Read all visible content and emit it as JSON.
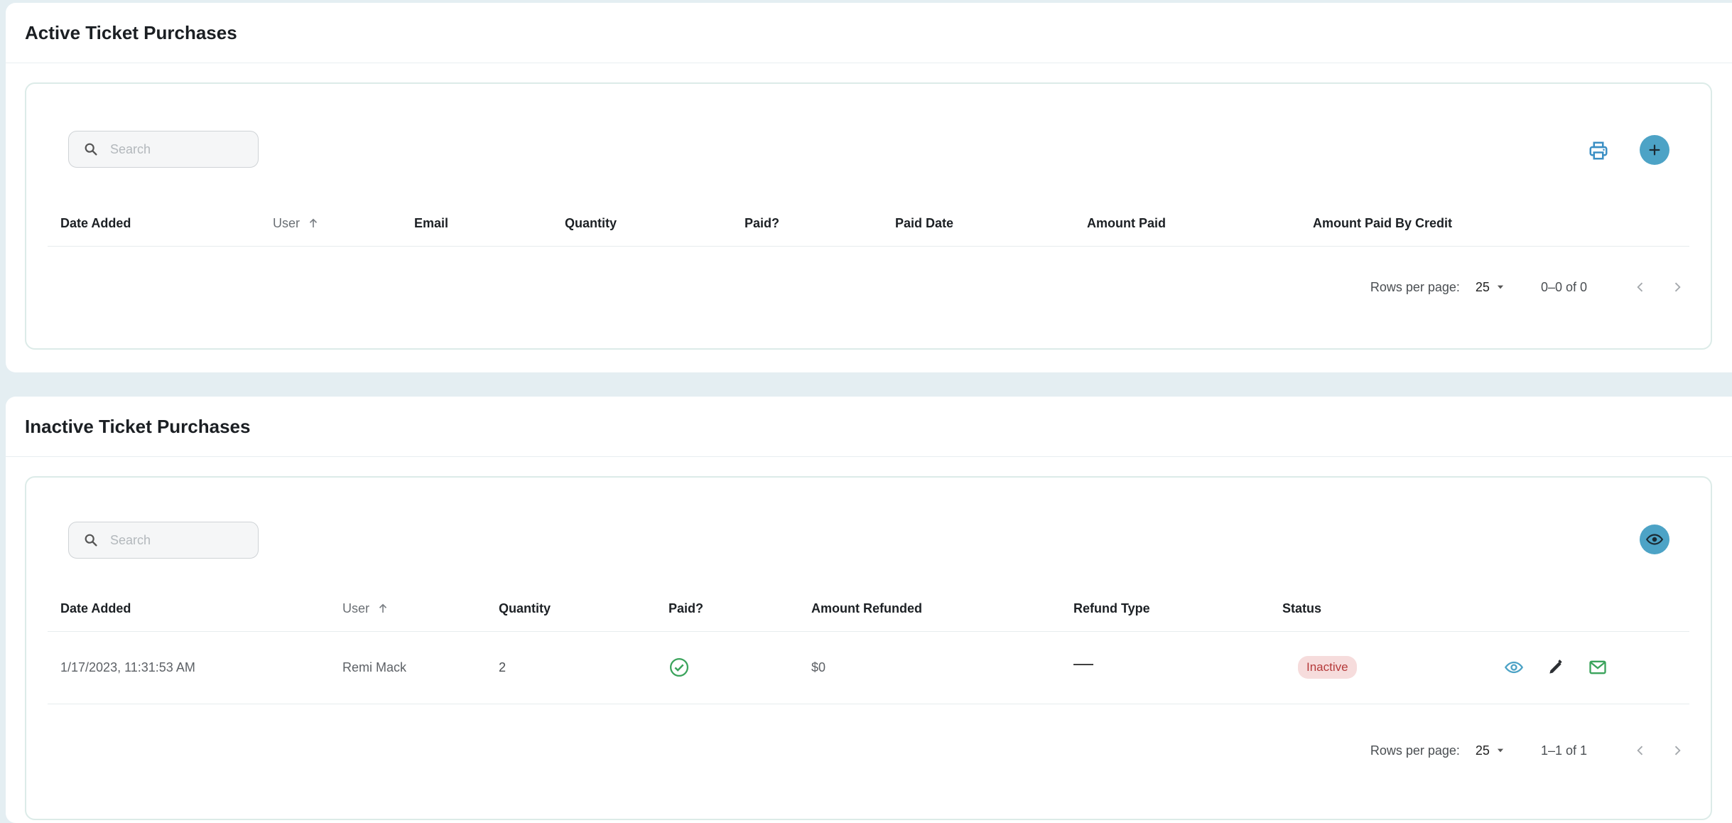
{
  "active": {
    "title": "Active Ticket Purchases",
    "search_placeholder": "Search",
    "columns": [
      "Date Added",
      "User",
      "Email",
      "Quantity",
      "Paid?",
      "Paid Date",
      "Amount Paid",
      "Amount Paid By Credit"
    ],
    "pagination": {
      "rows_per_page_label": "Rows per page:",
      "rows_per_page": "25",
      "range": "0–0 of 0"
    },
    "icons": {
      "print": "print-icon",
      "add": "plus-icon"
    }
  },
  "inactive": {
    "title": "Inactive Ticket Purchases",
    "search_placeholder": "Search",
    "columns": [
      "Date Added",
      "User",
      "Quantity",
      "Paid?",
      "Amount Refunded",
      "Refund Type",
      "Status"
    ],
    "rows": [
      {
        "date_added": "1/17/2023, 11:31:53 AM",
        "user": "Remi Mack",
        "quantity": "2",
        "paid": true,
        "amount_refunded": "$0",
        "refund_type": "—",
        "status": "Inactive"
      }
    ],
    "pagination": {
      "rows_per_page_label": "Rows per page:",
      "rows_per_page": "25",
      "range": "1–1 of 1"
    },
    "icons": {
      "toggle_view": "eye-icon",
      "row_view": "eye-icon",
      "row_edit": "pencil-icon",
      "row_email": "mail-icon"
    }
  },
  "colors": {
    "accent": "#4da3c6",
    "success": "#3aa35b",
    "inactive_badge_bg": "#f6dcdc",
    "inactive_badge_text": "#b53b3b",
    "email_icon": "#3aa35b",
    "print_icon": "#3b8fc4"
  }
}
